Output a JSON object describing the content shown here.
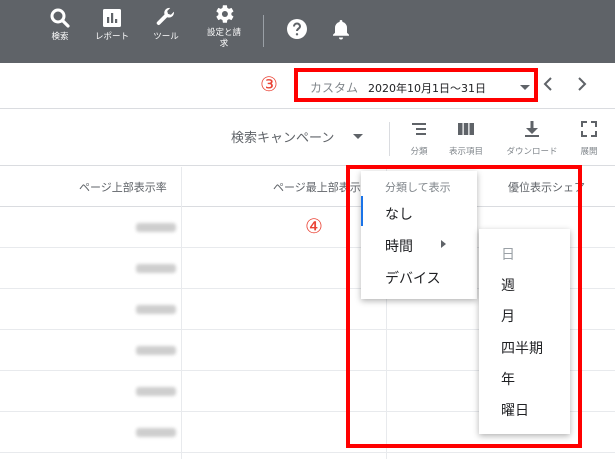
{
  "topbar": {
    "items": [
      {
        "label": "検索",
        "icon": "search-icon"
      },
      {
        "label": "レポート",
        "icon": "report-icon"
      },
      {
        "label": "ツール",
        "icon": "wrench-icon"
      },
      {
        "label": "設定と請求",
        "icon": "gear-icon"
      }
    ],
    "help_icon": "help-icon",
    "bell_icon": "notification-bell-icon"
  },
  "date_range": {
    "callout_number": "③",
    "custom_label": "カスタム",
    "range": "2020年10月1日～31日",
    "prev_icon": "chevron-left-icon",
    "next_icon": "chevron-right-icon"
  },
  "toolbar": {
    "segment_select": "検索キャンペーン",
    "tools": [
      {
        "label": "分類",
        "icon": "segment-icon"
      },
      {
        "label": "表示項目",
        "icon": "columns-icon"
      },
      {
        "label": "ダウンロード",
        "icon": "download-icon"
      },
      {
        "label": "展開",
        "icon": "expand-icon"
      }
    ]
  },
  "table": {
    "headers": [
      "ページ上部表示率",
      "ページ最上部表示",
      "優位表示シェア"
    ]
  },
  "segment_menu": {
    "callout_number": "④",
    "header": "分類して表示",
    "items": [
      "なし",
      "時間",
      "デバイス"
    ]
  },
  "time_submenu": {
    "items": [
      "日",
      "週",
      "月",
      "四半期",
      "年",
      "曜日"
    ]
  },
  "colors": {
    "topbar_bg": "#5f6368",
    "highlight_red": "#ff0000",
    "callout_red": "#ea4335",
    "accent_blue": "#1a73e8"
  }
}
